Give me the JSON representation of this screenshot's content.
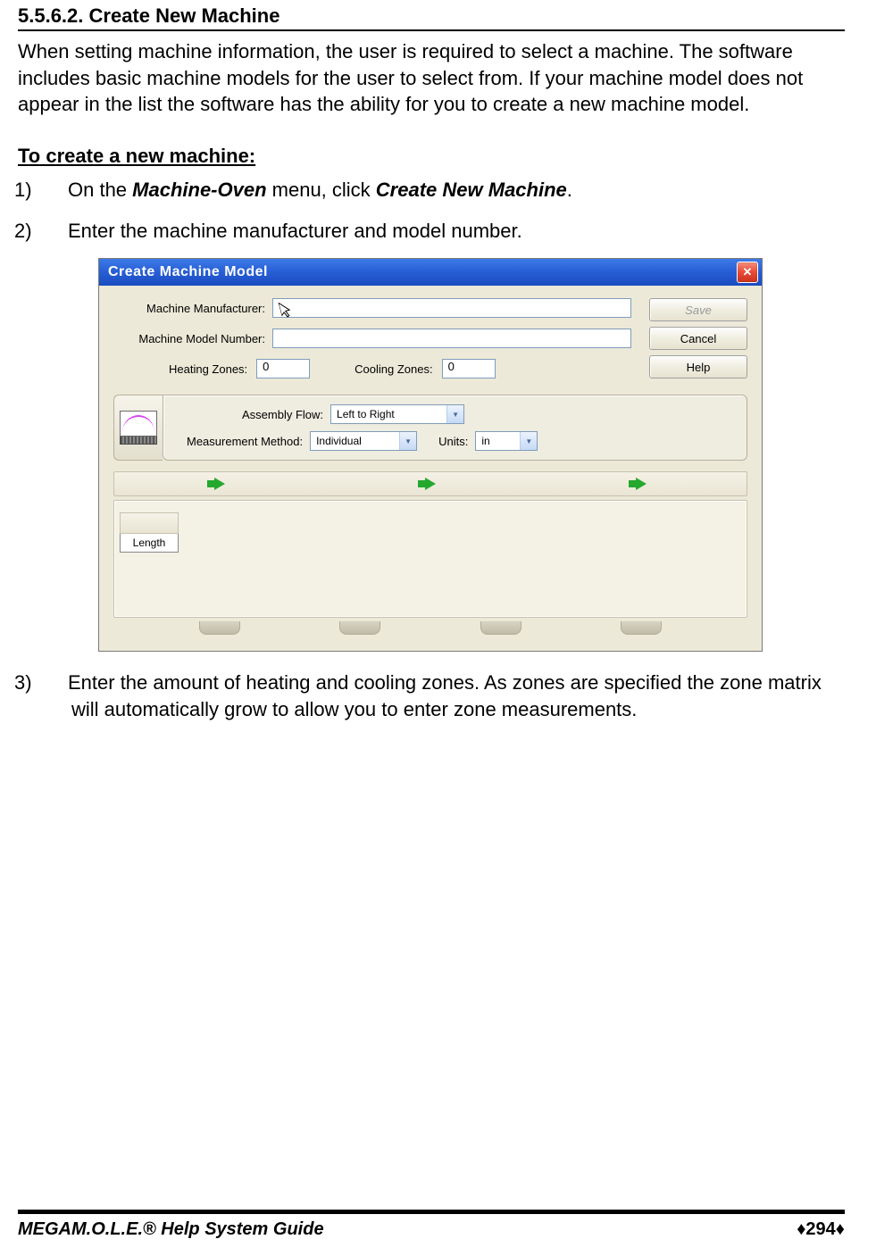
{
  "heading": "5.5.6.2. Create New Machine",
  "intro": "When setting machine information, the user is required to select a machine. The software includes basic machine models for the user to select from. If your machine model does not appear in the list the software has the ability for you to create a new machine model.",
  "subheading": "To create a new machine:",
  "steps": {
    "s1_pre": "On the ",
    "s1_em1": "Machine-Oven",
    "s1_mid": " menu, click ",
    "s1_em2": "Create New Machine",
    "s1_post": ".",
    "s2": "Enter the machine manufacturer and model number.",
    "s3": "Enter the amount of heating and cooling zones. As zones are specified the zone matrix will automatically grow to allow you to enter zone measurements."
  },
  "dialog": {
    "title": "Create Machine Model",
    "labels": {
      "manufacturer": "Machine Manufacturer:",
      "model": "Machine Model Number:",
      "heating": "Heating Zones:",
      "cooling": "Cooling Zones:",
      "assembly": "Assembly Flow:",
      "measurement": "Measurement Method:",
      "units": "Units:",
      "length": "Length"
    },
    "values": {
      "manufacturer": "",
      "model": "",
      "heating": "0",
      "cooling": "0",
      "assembly": "Left to Right",
      "measurement": "Individual",
      "units": "in"
    },
    "buttons": {
      "save": "Save",
      "cancel": "Cancel",
      "help": "Help"
    }
  },
  "footer": {
    "product_em": "MEGA",
    "product_rest": "M.O.L.E.® Help System Guide",
    "page": "294"
  }
}
